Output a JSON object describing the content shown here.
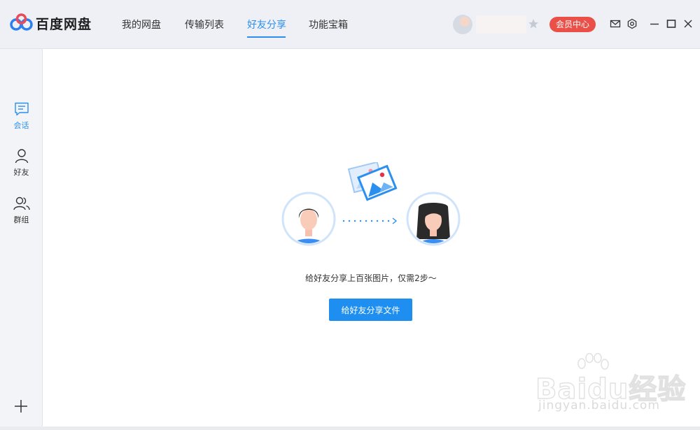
{
  "app": {
    "name": "百度网盘"
  },
  "nav": [
    {
      "label": "我的网盘",
      "active": false
    },
    {
      "label": "传输列表",
      "active": false
    },
    {
      "label": "好友分享",
      "active": true
    },
    {
      "label": "功能宝箱",
      "active": false
    }
  ],
  "header": {
    "vip_label": "会员中心"
  },
  "sidebar": {
    "items": [
      {
        "label": "会话",
        "icon": "chat-icon",
        "active": true
      },
      {
        "label": "好友",
        "icon": "user-icon",
        "active": false
      },
      {
        "label": "群组",
        "icon": "group-icon",
        "active": false
      }
    ]
  },
  "main": {
    "empty_text": "给好友分享上百张图片，仅需2步～",
    "share_button": "给好友分享文件"
  },
  "watermark": {
    "main": "Baidu经验",
    "sub": "jingyan.baidu.com"
  },
  "colors": {
    "accent": "#2b8ff0",
    "vip": "#ea5047",
    "button": "#1e8ff0"
  }
}
